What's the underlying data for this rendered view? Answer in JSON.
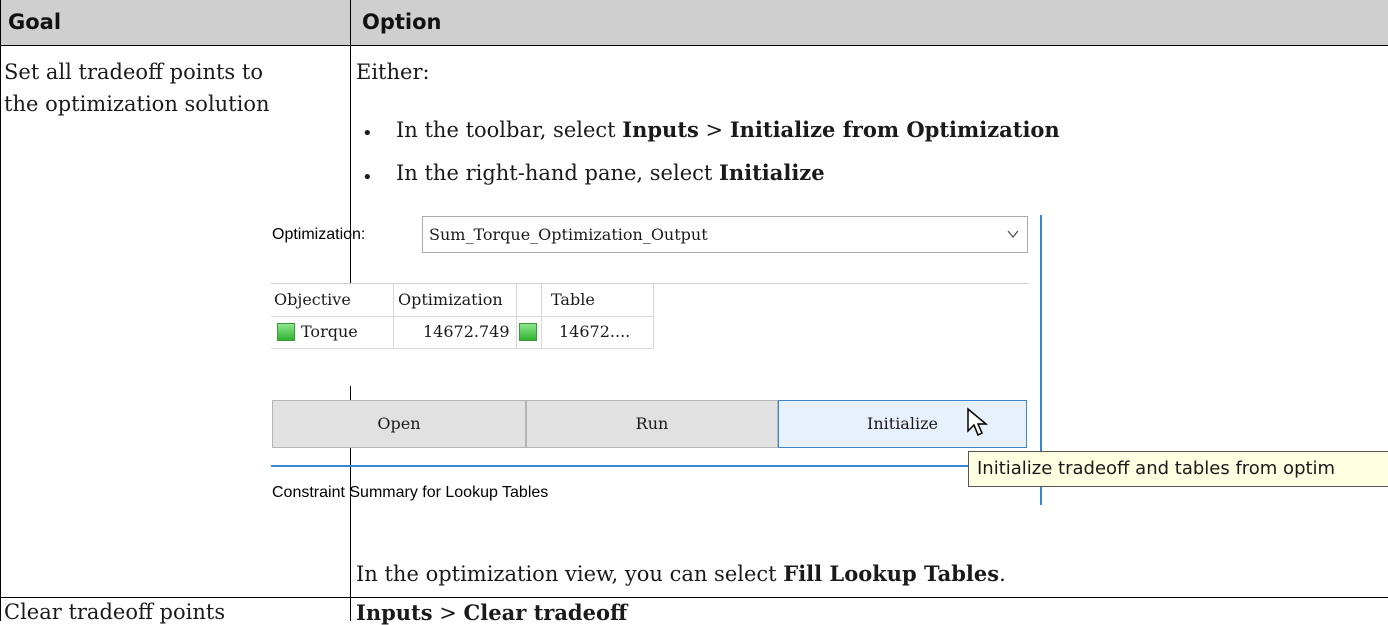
{
  "table": {
    "headers": {
      "goal": "Goal",
      "option": "Option"
    },
    "row1": {
      "goal_line1": "Set all tradeoff points to",
      "goal_line2": "the optimization solution",
      "either": "Either:",
      "bullets": [
        {
          "prefix": "In the toolbar, select ",
          "bold1": "Inputs",
          "sep": " > ",
          "bold2": "Initialize from Optimization"
        },
        {
          "prefix": "In the right-hand pane, select ",
          "bold1": "Initialize"
        }
      ],
      "note_prefix": "In the optimization view, you can select ",
      "note_bold": "Fill Lookup Tables",
      "note_suffix": "."
    },
    "row2": {
      "goal": "Clear tradeoff points",
      "option_bold1": "Inputs",
      "sep": " > ",
      "option_bold2": "Clear tradeoff"
    }
  },
  "screenshot": {
    "optimization_label": "Optimization:",
    "optimization_value": "Sum_Torque_Optimization_Output",
    "columns": [
      "Objective",
      "Optimization",
      "",
      "Table"
    ],
    "row": {
      "objective": "Torque",
      "optimization": "14672.749",
      "table": "14672...."
    },
    "buttons": {
      "open": "Open",
      "run": "Run",
      "initialize": "Initialize"
    },
    "tooltip": "Initialize tradeoff and tables from optim",
    "section_title": "Constraint Summary for Lookup Tables",
    "swatch_color": "#4cc94c",
    "accent_color": "#3a86d0"
  }
}
